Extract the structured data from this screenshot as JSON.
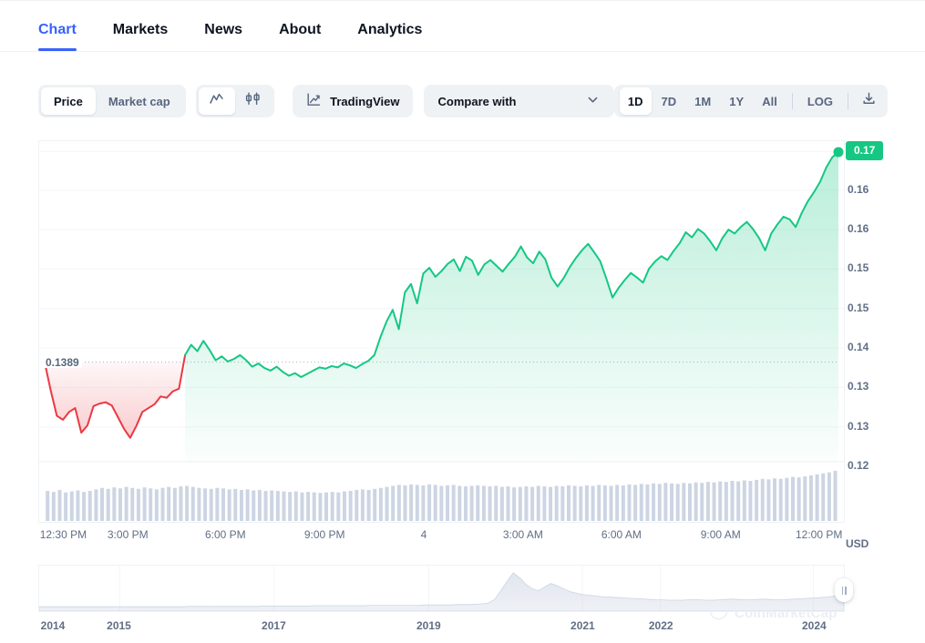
{
  "nav": {
    "tabs": [
      {
        "label": "Chart",
        "active": true
      },
      {
        "label": "Markets",
        "active": false
      },
      {
        "label": "News",
        "active": false
      },
      {
        "label": "About",
        "active": false
      },
      {
        "label": "Analytics",
        "active": false
      }
    ]
  },
  "toolbar": {
    "metric_toggle": [
      {
        "label": "Price",
        "active": true
      },
      {
        "label": "Market cap",
        "active": false
      }
    ],
    "chart_type": [
      {
        "icon": "line-chart-icon",
        "active": true
      },
      {
        "icon": "candlestick-chart-icon",
        "active": false
      }
    ],
    "tradingview": {
      "label": "TradingView",
      "icon": "tradingview-icon"
    },
    "compare": {
      "label": "Compare with",
      "icon": "chevron-down-icon"
    },
    "ranges": [
      {
        "label": "1D",
        "active": true
      },
      {
        "label": "7D",
        "active": false
      },
      {
        "label": "1M",
        "active": false
      },
      {
        "label": "1Y",
        "active": false
      },
      {
        "label": "All",
        "active": false
      }
    ],
    "log_label": "LOG",
    "download_icon": "download-icon"
  },
  "chart_data": {
    "type": "area",
    "title": "",
    "xlabel": "",
    "ylabel": "USD",
    "currency": "USD",
    "grid": true,
    "legend": false,
    "reference_line": {
      "value": 0.1389,
      "label": "0.1389"
    },
    "last_value_badge": "0.17",
    "colors": {
      "up": "#16c784",
      "down": "#ea3943",
      "volume": "#cdd5e3",
      "grid": "#f3f5f9",
      "axis_text": "#616e85",
      "accent": "#3861fb"
    },
    "ylim": [
      0.1235,
      0.1728
    ],
    "y_ticks": [
      {
        "label": "0.17",
        "value": 0.1715,
        "highlight": true
      },
      {
        "label": "0.16",
        "value": 0.1655,
        "highlight": false
      },
      {
        "label": "0.16",
        "value": 0.1594,
        "highlight": false
      },
      {
        "label": "0.15",
        "value": 0.1533,
        "highlight": false
      },
      {
        "label": "0.15",
        "value": 0.1472,
        "highlight": false
      },
      {
        "label": "0.14",
        "value": 0.1411,
        "highlight": false
      },
      {
        "label": "0.13",
        "value": 0.135,
        "highlight": false
      },
      {
        "label": "0.13",
        "value": 0.1289,
        "highlight": false
      },
      {
        "label": "0.12",
        "value": 0.1228,
        "highlight": false
      }
    ],
    "x_ticks": [
      {
        "label": "12:30 PM",
        "pos": 0.031
      },
      {
        "label": "3:00 PM",
        "pos": 0.111
      },
      {
        "label": "6:00 PM",
        "pos": 0.232
      },
      {
        "label": "9:00 PM",
        "pos": 0.355
      },
      {
        "label": "4",
        "pos": 0.478
      },
      {
        "label": "3:00 AM",
        "pos": 0.601
      },
      {
        "label": "6:00 AM",
        "pos": 0.723
      },
      {
        "label": "9:00 AM",
        "pos": 0.846
      },
      {
        "label": "12:00 PM",
        "pos": 0.968
      }
    ],
    "price_series": [
      0.1389,
      0.1345,
      0.1306,
      0.13,
      0.1312,
      0.1318,
      0.128,
      0.1291,
      0.1321,
      0.1325,
      0.1327,
      0.1322,
      0.1304,
      0.1286,
      0.1272,
      0.129,
      0.1312,
      0.1318,
      0.1324,
      0.1336,
      0.1334,
      0.1344,
      0.1348,
      0.14,
      0.1416,
      0.1406,
      0.1422,
      0.1408,
      0.1392,
      0.1398,
      0.139,
      0.1394,
      0.14,
      0.1392,
      0.1382,
      0.1387,
      0.138,
      0.1376,
      0.1382,
      0.1374,
      0.1368,
      0.1372,
      0.1366,
      0.1371,
      0.1376,
      0.1381,
      0.1379,
      0.1383,
      0.1381,
      0.1387,
      0.1384,
      0.138,
      0.1386,
      0.1391,
      0.14,
      0.1428,
      0.1452,
      0.147,
      0.144,
      0.1497,
      0.151,
      0.148,
      0.1526,
      0.1535,
      0.1521,
      0.153,
      0.1541,
      0.1548,
      0.153,
      0.1552,
      0.1546,
      0.1524,
      0.154,
      0.1547,
      0.1538,
      0.1529,
      0.1541,
      0.1552,
      0.1568,
      0.1551,
      0.1542,
      0.156,
      0.1548,
      0.152,
      0.1506,
      0.1519,
      0.1536,
      0.155,
      0.1562,
      0.1572,
      0.1559,
      0.1545,
      0.1518,
      0.1489,
      0.1504,
      0.1516,
      0.1527,
      0.152,
      0.1512,
      0.1534,
      0.1545,
      0.1553,
      0.1547,
      0.1561,
      0.1573,
      0.159,
      0.1582,
      0.1595,
      0.1588,
      0.1576,
      0.1562,
      0.1581,
      0.1594,
      0.1588,
      0.1598,
      0.1606,
      0.1595,
      0.1581,
      0.1562,
      0.1588,
      0.1602,
      0.1614,
      0.161,
      0.1598,
      0.162,
      0.1638,
      0.1652,
      0.1668,
      0.169,
      0.1706,
      0.1714
    ],
    "volume_series": [
      0.6,
      0.58,
      0.62,
      0.57,
      0.59,
      0.61,
      0.58,
      0.6,
      0.63,
      0.66,
      0.64,
      0.67,
      0.65,
      0.68,
      0.66,
      0.64,
      0.67,
      0.65,
      0.63,
      0.66,
      0.68,
      0.66,
      0.69,
      0.7,
      0.68,
      0.66,
      0.65,
      0.64,
      0.66,
      0.65,
      0.63,
      0.64,
      0.62,
      0.63,
      0.61,
      0.62,
      0.6,
      0.61,
      0.6,
      0.59,
      0.58,
      0.59,
      0.57,
      0.58,
      0.57,
      0.56,
      0.57,
      0.58,
      0.57,
      0.59,
      0.6,
      0.62,
      0.63,
      0.62,
      0.64,
      0.66,
      0.68,
      0.7,
      0.72,
      0.71,
      0.73,
      0.72,
      0.71,
      0.73,
      0.72,
      0.7,
      0.71,
      0.72,
      0.7,
      0.69,
      0.7,
      0.71,
      0.7,
      0.69,
      0.7,
      0.68,
      0.69,
      0.67,
      0.68,
      0.69,
      0.68,
      0.7,
      0.69,
      0.68,
      0.7,
      0.69,
      0.71,
      0.7,
      0.69,
      0.71,
      0.7,
      0.72,
      0.71,
      0.7,
      0.72,
      0.71,
      0.73,
      0.72,
      0.74,
      0.73,
      0.75,
      0.74,
      0.76,
      0.75,
      0.74,
      0.76,
      0.75,
      0.77,
      0.76,
      0.78,
      0.77,
      0.79,
      0.78,
      0.8,
      0.79,
      0.81,
      0.8,
      0.82,
      0.84,
      0.83,
      0.85,
      0.84,
      0.86,
      0.88,
      0.87,
      0.89,
      0.91,
      0.93,
      0.95,
      0.97,
      1.0
    ],
    "watermark": "CoinMarketCap"
  },
  "navigator": {
    "x_ticks": [
      {
        "label": "2014",
        "pos": 0.007
      },
      {
        "label": "2015",
        "pos": 0.1
      },
      {
        "label": "2017",
        "pos": 0.292
      },
      {
        "label": "2019",
        "pos": 0.484
      },
      {
        "label": "2021",
        "pos": 0.675
      },
      {
        "label": "2022",
        "pos": 0.772
      },
      {
        "label": "2024",
        "pos": 0.962
      }
    ],
    "series": [
      0.02,
      0.02,
      0.02,
      0.02,
      0.02,
      0.02,
      0.02,
      0.02,
      0.02,
      0.02,
      0.02,
      0.02,
      0.02,
      0.02,
      0.02,
      0.02,
      0.02,
      0.02,
      0.02,
      0.02,
      0.02,
      0.02,
      0.02,
      0.02,
      0.03,
      0.03,
      0.03,
      0.03,
      0.03,
      0.03,
      0.03,
      0.03,
      0.03,
      0.03,
      0.03,
      0.03,
      0.04,
      0.04,
      0.04,
      0.04,
      0.04,
      0.04,
      0.04,
      0.04,
      0.05,
      0.05,
      0.05,
      0.05,
      0.05,
      0.05,
      0.05,
      0.05,
      0.05,
      0.06,
      0.06,
      0.06,
      0.06,
      0.06,
      0.06,
      0.06,
      0.06,
      0.06,
      0.07,
      0.07,
      0.07,
      0.07,
      0.07,
      0.08,
      0.08,
      0.08,
      0.09,
      0.1,
      0.12,
      0.22,
      0.46,
      0.72,
      0.95,
      0.82,
      0.64,
      0.52,
      0.46,
      0.56,
      0.66,
      0.6,
      0.52,
      0.44,
      0.4,
      0.36,
      0.34,
      0.32,
      0.3,
      0.29,
      0.28,
      0.27,
      0.26,
      0.25,
      0.24,
      0.23,
      0.22,
      0.21,
      0.21,
      0.2,
      0.2,
      0.2,
      0.21,
      0.22,
      0.21,
      0.2,
      0.2,
      0.21,
      0.22,
      0.23,
      0.22,
      0.21,
      0.21,
      0.22,
      0.23,
      0.22,
      0.21,
      0.21,
      0.22,
      0.23,
      0.24,
      0.25,
      0.26,
      0.27,
      0.28,
      0.3,
      0.32,
      0.35
    ],
    "handle_icon": "drag-handle-icon"
  }
}
